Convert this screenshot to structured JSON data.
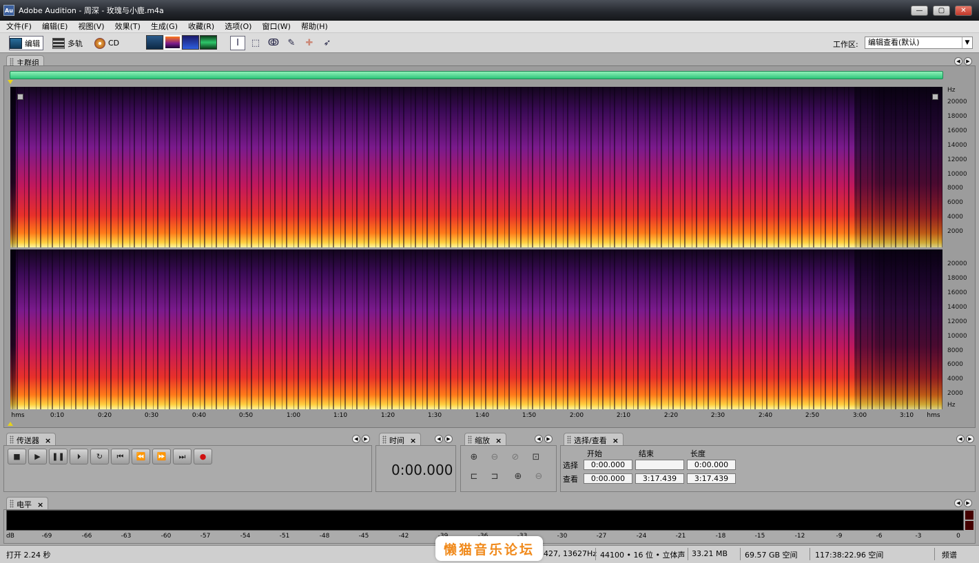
{
  "window": {
    "app_badge": "Au",
    "title": "Adobe Audition - 周深 - 玫瑰与小鹿.m4a",
    "minimize_glyph": "—",
    "maximize_glyph": "▢",
    "close_glyph": "✕"
  },
  "menu": [
    "文件(F)",
    "编辑(E)",
    "视图(V)",
    "效果(T)",
    "生成(G)",
    "收藏(R)",
    "选项(O)",
    "窗口(W)",
    "帮助(H)"
  ],
  "toolbar": {
    "edit_label": "编辑",
    "multitrack_label": "多轨",
    "cd_label": "CD",
    "workspace_label": "工作区:",
    "workspace_value": "编辑查看(默认)",
    "active_view": "spectral-frequency",
    "active_tool": "time-selection"
  },
  "main_panel": {
    "tab_label": "主群组",
    "hz_unit": "Hz",
    "hz_ticks_top": [
      "20000",
      "18000",
      "16000",
      "14000",
      "12000",
      "10000",
      "8000",
      "6000",
      "4000",
      "2000"
    ],
    "hz_ticks_bottom": [
      "20000",
      "18000",
      "16000",
      "14000",
      "12000",
      "10000",
      "8000",
      "6000",
      "4000",
      "2000"
    ],
    "time_unit": "hms",
    "time_ticks": [
      "0:10",
      "0:20",
      "0:30",
      "0:40",
      "0:50",
      "1:00",
      "1:10",
      "1:20",
      "1:30",
      "1:40",
      "1:50",
      "2:00",
      "2:10",
      "2:20",
      "2:30",
      "2:40",
      "2:50",
      "3:00",
      "3:10"
    ]
  },
  "transport": {
    "tab_label": "传送器",
    "close_glyph": "×",
    "buttons": [
      "■",
      "▶",
      "❚❚",
      "⏵",
      "↻",
      "⏮",
      "⏪",
      "⏩",
      "⏭",
      "●"
    ]
  },
  "time_panel": {
    "tab_label": "时间",
    "close_glyph": "×",
    "value": "0:00.000"
  },
  "zoom_panel": {
    "tab_label": "缩放",
    "close_glyph": "×"
  },
  "selection_view": {
    "tab_label": "选择/查看",
    "close_glyph": "×",
    "col_start": "开始",
    "col_end": "结束",
    "col_length": "长度",
    "row_selection": "选择",
    "row_view": "查看",
    "sel_start": "0:00.000",
    "sel_end": "",
    "sel_length": "0:00.000",
    "view_start": "0:00.000",
    "view_end": "3:17.439",
    "view_length": "3:17.439"
  },
  "level_panel": {
    "tab_label": "电平",
    "close_glyph": "×",
    "scale": [
      "dB",
      "-69",
      "-66",
      "-63",
      "-60",
      "-57",
      "-54",
      "-51",
      "-48",
      "-45",
      "-42",
      "-39",
      "-36",
      "-33",
      "-30",
      "-27",
      "-24",
      "-21",
      "-18",
      "-15",
      "-12",
      "-9",
      "-6",
      "-3",
      "0"
    ]
  },
  "status": {
    "open_time": "打开 2.24 秒",
    "cursor": "427, 13627Hz",
    "format": "44100 • 16 位 • 立体声",
    "file_size": "33.21 MB",
    "free_space": "69.57 GB 空间",
    "free_time": "117:38:22.96 空间",
    "view_mode": "频谱"
  },
  "watermark": "懒猫音乐论坛",
  "colors": {
    "overview_bar": "#2ec67a",
    "spectrum_high": "#fff6a0",
    "spectrum_mid": "#e8302a",
    "spectrum_low": "#3a0a55",
    "record_red": "#d01010",
    "watermark": "#f08a1c"
  }
}
